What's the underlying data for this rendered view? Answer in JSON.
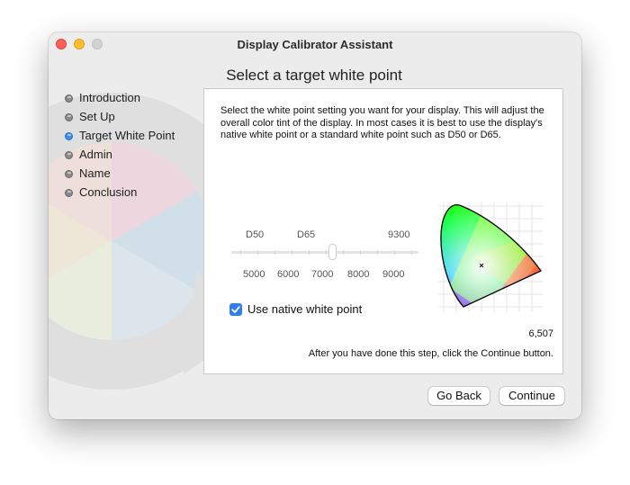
{
  "window": {
    "title": "Display Calibrator Assistant"
  },
  "page_title": "Select a target white point",
  "steps": [
    {
      "label": "Introduction",
      "active": false
    },
    {
      "label": "Set Up",
      "active": false
    },
    {
      "label": "Target White Point",
      "active": true
    },
    {
      "label": "Admin",
      "active": false
    },
    {
      "label": "Name",
      "active": false
    },
    {
      "label": "Conclusion",
      "active": false
    }
  ],
  "description": "Select the white point setting you want for your display.  This will adjust the overall color tint of the display.  In most cases it is best to use the display's native white point or a standard white point such as D50 or D65.",
  "slider": {
    "presets": [
      "D50",
      "D65",
      "9300"
    ],
    "scale": [
      "5000",
      "6000",
      "7000",
      "8000",
      "9000"
    ]
  },
  "native_checkbox": {
    "label": "Use native white point",
    "checked": true
  },
  "white_point_value": "6,507",
  "after_text": "After you have done this step, click the Continue button.",
  "buttons": {
    "back": "Go Back",
    "continue": "Continue"
  },
  "colors": {
    "active_step": "#3f8fe6",
    "checkbox": "#2f7ef6",
    "close": "#fe5f57",
    "minimize": "#febc2e"
  },
  "icons": [
    "close-icon",
    "minimize-icon",
    "zoom-icon",
    "checkmark-icon",
    "cie-chromaticity-diagram",
    "white-point-marker-icon"
  ]
}
